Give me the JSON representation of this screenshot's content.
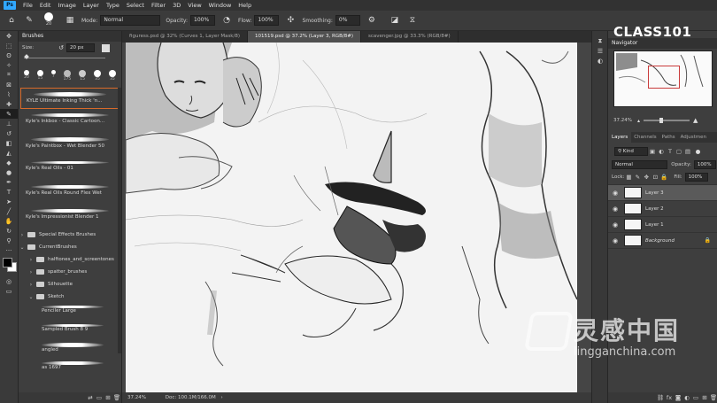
{
  "menu": {
    "logo": "Ps",
    "items": [
      "File",
      "Edit",
      "Image",
      "Layer",
      "Type",
      "Select",
      "Filter",
      "3D",
      "View",
      "Window",
      "Help"
    ]
  },
  "options": {
    "brush_size": "20",
    "mode_label": "Mode:",
    "mode_value": "Normal",
    "opacity_label": "Opacity:",
    "opacity_value": "100%",
    "flow_label": "Flow:",
    "flow_value": "100%",
    "smoothing_label": "Smoothing:",
    "smoothing_value": "0%"
  },
  "brushes_panel": {
    "tab": "Brushes",
    "size_label": "Size:",
    "size_value": "20 px",
    "presets": [
      "20",
      "15",
      "7",
      "175",
      "15",
      "35",
      "35"
    ],
    "brushes": [
      "KYLE Ultimate Inking Thick 'n...",
      "Kyle's Inkbox - Classic Cartoon...",
      "Kyle's Paintbox - Wet Blender 50",
      "Kyle's Real Oils - 01",
      "Kyle's Real Oils Round Flex Wet",
      "Kyle's Impressionist Blender 1"
    ],
    "folders": [
      {
        "name": "Special Effects Brushes",
        "indent": 0,
        "open": false
      },
      {
        "name": "CurrentBrushes",
        "indent": 0,
        "open": true
      },
      {
        "name": "halftones_and_screentones",
        "indent": 1,
        "open": false
      },
      {
        "name": "spatter_brushes",
        "indent": 1,
        "open": false
      },
      {
        "name": "Silhouette",
        "indent": 1,
        "open": false
      },
      {
        "name": "Sketch",
        "indent": 1,
        "open": true
      }
    ],
    "sketch_brushes": [
      "Penciler Large",
      "Sampled Brush 8 9",
      "angled",
      "as 1697"
    ]
  },
  "doc_tabs": [
    {
      "label": "figuress.psd @ 32% (Curves 1, Layer Mask/8)",
      "active": false
    },
    {
      "label": "101519.psd @ 37.2% (Layer 3, RGB/8#)",
      "active": true
    },
    {
      "label": "scavenger.jpg @ 33.3% (RGB/8#)",
      "active": false
    }
  ],
  "status": {
    "zoom": "37.24%",
    "doc": "Doc: 100.1M/166.0M"
  },
  "navigator": {
    "tab": "Navigator",
    "zoom": "37.24%"
  },
  "layers_panel": {
    "tabs": [
      "Layers",
      "Channels",
      "Paths",
      "Adjustmen"
    ],
    "kind": "Kind",
    "blend_mode": "Normal",
    "opacity_label": "Opacity:",
    "opacity_value": "100%",
    "lock_label": "Lock:",
    "fill_label": "Fill:",
    "fill_value": "100%",
    "layers": [
      "Layer 3",
      "Layer 2",
      "Layer 1",
      "Background"
    ],
    "selected_index": 0
  },
  "watermarks": {
    "brand": "CLASS101",
    "site_cn": "灵感中国",
    "site_url": "lingganchina.com"
  },
  "colors": {
    "accent": "#31a8ff",
    "selection": "#c93b3b",
    "brush_highlight": "#d86a2a"
  }
}
